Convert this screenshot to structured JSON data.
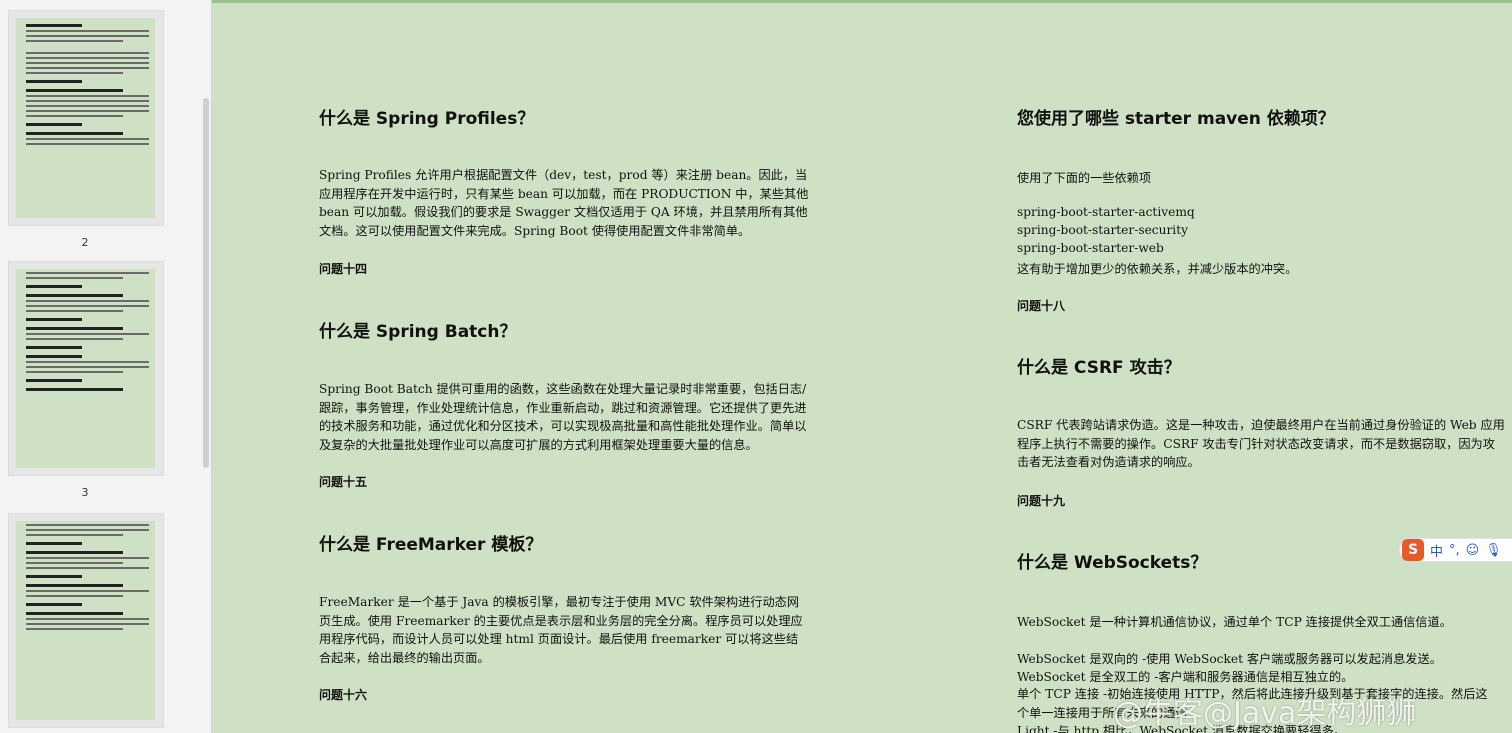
{
  "sidebar": {
    "pages": [
      {
        "num": "2"
      },
      {
        "num": "3"
      }
    ]
  },
  "left": {
    "h1": "什么是 Spring Profiles？",
    "p1": "Spring Profiles 允许用户根据配置文件（dev，test，prod 等）来注册 bean。因此，当应用程序在开发中运行时，只有某些 bean 可以加载，而在 PRODUCTION 中，某些其他 bean 可以加载。假设我们的要求是 Swagger 文档仅适用于 QA 环境，并且禁用所有其他文档。这可以使用配置文件来完成。Spring Boot 使得使用配置文件非常简单。",
    "q14": "问题十四",
    "h2": "什么是 Spring Batch？",
    "p2": "Spring Boot Batch 提供可重用的函数，这些函数在处理大量记录时非常重要，包括日志/跟踪，事务管理，作业处理统计信息，作业重新启动，跳过和资源管理。它还提供了更先进的技术服务和功能，通过优化和分区技术，可以实现极高批量和高性能批处理作业。简单以及复杂的大批量批处理作业可以高度可扩展的方式利用框架处理重要大量的信息。",
    "q15": "问题十五",
    "h3": "什么是 FreeMarker 模板？",
    "p3": "FreeMarker 是一个基于 Java 的模板引擎，最初专注于使用 MVC 软件架构进行动态网页生成。使用 Freemarker 的主要优点是表示层和业务层的完全分离。程序员可以处理应用程序代码，而设计人员可以处理 html 页面设计。最后使用 freemarker 可以将这些结合起来，给出最终的输出页面。",
    "q16": "问题十六"
  },
  "right": {
    "h1": "您使用了哪些 starter maven 依赖项？",
    "intro": "使用了下面的一些依赖项",
    "deps": [
      "spring-boot-starter-activemq",
      "spring-boot-starter-security",
      "spring-boot-starter-web"
    ],
    "after": "这有助于增加更少的依赖关系，并减少版本的冲突。",
    "q18": "问题十八",
    "h2": "什么是 CSRF 攻击？",
    "p2": "CSRF 代表跨站请求伪造。这是一种攻击，迫使最终用户在当前通过身份验证的 Web 应用程序上执行不需要的操作。CSRF 攻击专门针对状态改变请求，而不是数据窃取，因为攻击者无法查看对伪造请求的响应。",
    "q19": "问题十九",
    "h3": "什么是 WebSockets？",
    "p3a": "WebSocket 是一种计算机通信协议，通过单个 TCP 连接提供全双工通信信道。",
    "ws1": "WebSocket 是双向的  -使用 WebSocket 客户端或服务器可以发起消息发送。",
    "ws2": "WebSocket 是全双工的  -客户端和服务器通信是相互独立的。",
    "ws3": "单个 TCP 连接  -初始连接使用 HTTP，然后将此连接升级到基于套接字的连接。然后这个单一连接用于所有未来的通信",
    "ws4": "Light -与 http 相比，WebSocket 消息数据交换要轻得多。"
  },
  "ime": {
    "mode": "中",
    "punct": "°,",
    "icon": "sogou-ime-icon"
  },
  "watermark": "@牛客@Java架构狮狮"
}
